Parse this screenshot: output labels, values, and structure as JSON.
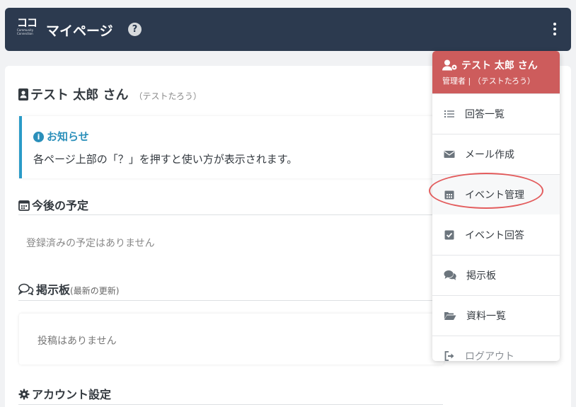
{
  "header": {
    "logo_mark": "ココ",
    "logo_sub_1": "Community",
    "logo_sub_2": "Connection",
    "title": "マイページ",
    "help_label": "?"
  },
  "profile": {
    "name": "テスト 太郎 さん",
    "kana": "（テストたろう）"
  },
  "notice": {
    "icon_label": "i",
    "title": "お知らせ",
    "body": "各ページ上部の「？」を押すと使い方が表示されます。"
  },
  "schedule": {
    "title": "今後の予定",
    "empty": "登録済みの予定はありません"
  },
  "board": {
    "title": "掲示板",
    "subtitle": "(最新の更新)",
    "empty": "投稿はありません"
  },
  "account": {
    "title": "アカウント設定"
  },
  "menu": {
    "user_name": "テスト 太郎 さん",
    "user_role": "管理者 | （テストたろう）",
    "items": [
      {
        "label": "回答一覧",
        "icon": "list-icon"
      },
      {
        "label": "メール作成",
        "icon": "envelope-icon"
      },
      {
        "label": "イベント管理",
        "icon": "calendar-icon"
      },
      {
        "label": "イベント回答",
        "icon": "check-square-icon"
      },
      {
        "label": "掲示板",
        "icon": "comments-icon"
      },
      {
        "label": "資料一覧",
        "icon": "folder-open-icon"
      },
      {
        "label": "ログアウト",
        "icon": "sign-out-icon"
      }
    ]
  },
  "colors": {
    "header_bg": "#2c3a4f",
    "menu_header_bg": "#cd5c5c",
    "notice_accent": "#2a8fba",
    "highlight_ring": "#dc2828"
  }
}
